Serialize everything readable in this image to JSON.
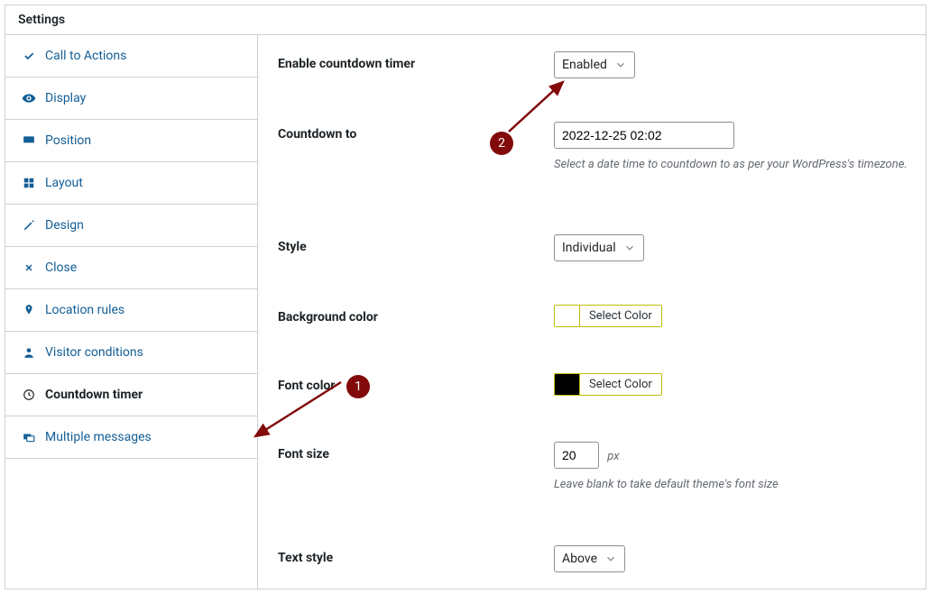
{
  "panel_title": "Settings",
  "sidebar": {
    "items": [
      {
        "label": "Call to Actions",
        "icon": "check"
      },
      {
        "label": "Display",
        "icon": "eye"
      },
      {
        "label": "Position",
        "icon": "rect"
      },
      {
        "label": "Layout",
        "icon": "grid"
      },
      {
        "label": "Design",
        "icon": "pencil"
      },
      {
        "label": "Close",
        "icon": "x"
      },
      {
        "label": "Location rules",
        "icon": "map"
      },
      {
        "label": "Visitor conditions",
        "icon": "user"
      },
      {
        "label": "Countdown timer",
        "icon": "clock"
      },
      {
        "label": "Multiple messages",
        "icon": "messages"
      }
    ],
    "active_index": 8
  },
  "fields": {
    "enable": {
      "label": "Enable countdown timer",
      "value": "Enabled"
    },
    "countdown_to": {
      "label": "Countdown to",
      "value": "2022-12-25 02:02",
      "help": "Select a date time to countdown to as per your WordPress's timezone."
    },
    "style": {
      "label": "Style",
      "value": "Individual"
    },
    "bg_color": {
      "label": "Background color",
      "button": "Select Color"
    },
    "font_color": {
      "label": "Font color",
      "button": "Select Color"
    },
    "font_size": {
      "label": "Font size",
      "value": "20",
      "unit": "px",
      "help": "Leave blank to take default theme's font size"
    },
    "text_style": {
      "label": "Text style",
      "value": "Above"
    }
  },
  "annotations": {
    "b1": "1",
    "b2": "2"
  }
}
